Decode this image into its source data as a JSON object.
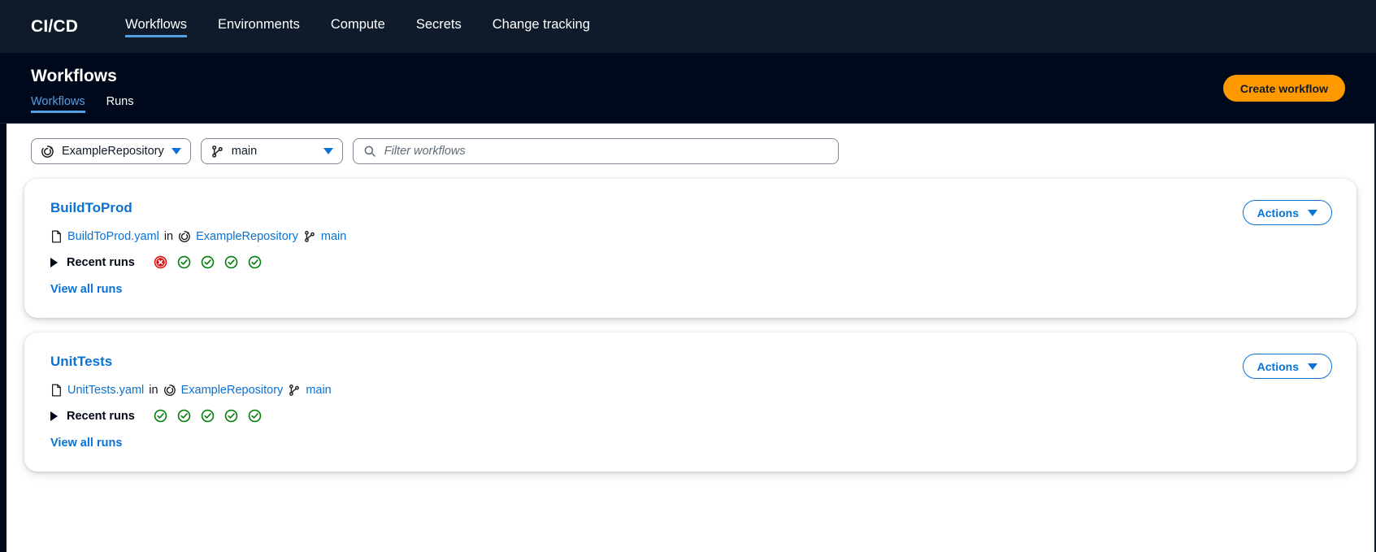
{
  "topnav": {
    "brand": "CI/CD",
    "links": [
      {
        "label": "Workflows",
        "active": true
      },
      {
        "label": "Environments",
        "active": false
      },
      {
        "label": "Compute",
        "active": false
      },
      {
        "label": "Secrets",
        "active": false
      },
      {
        "label": "Change tracking",
        "active": false
      }
    ]
  },
  "page_header": {
    "title": "Workflows",
    "subtabs": [
      {
        "label": "Workflows",
        "active": true
      },
      {
        "label": "Runs",
        "active": false
      }
    ],
    "create_button": "Create workflow"
  },
  "filter_bar": {
    "repository_select": {
      "value": "ExampleRepository",
      "icon": "repository-icon"
    },
    "branch_select": {
      "value": "main",
      "icon": "branch-icon"
    },
    "search": {
      "placeholder": "Filter workflows",
      "value": "",
      "icon": "search-icon"
    }
  },
  "workflows": [
    {
      "name": "BuildToProd",
      "file": "BuildToProd.yaml",
      "in_word": "in",
      "repository": "ExampleRepository",
      "branch": "main",
      "recent_runs_label": "Recent runs",
      "run_statuses": [
        "failed",
        "success",
        "success",
        "success",
        "success"
      ],
      "view_all_label": "View all runs",
      "actions_label": "Actions"
    },
    {
      "name": "UnitTests",
      "file": "UnitTests.yaml",
      "in_word": "in",
      "repository": "ExampleRepository",
      "branch": "main",
      "recent_runs_label": "Recent runs",
      "run_statuses": [
        "success",
        "success",
        "success",
        "success",
        "success"
      ],
      "view_all_label": "View all runs",
      "actions_label": "Actions"
    }
  ],
  "colors": {
    "topnav_bg": "#0f1b2a",
    "header_bg": "#00081b",
    "accent_orange": "#ff9900",
    "link_blue": "#0972d3",
    "active_tab_blue": "#539fe5",
    "status_success": "#037f0c",
    "status_failed": "#d91515",
    "page_bg": "#ffffff"
  }
}
